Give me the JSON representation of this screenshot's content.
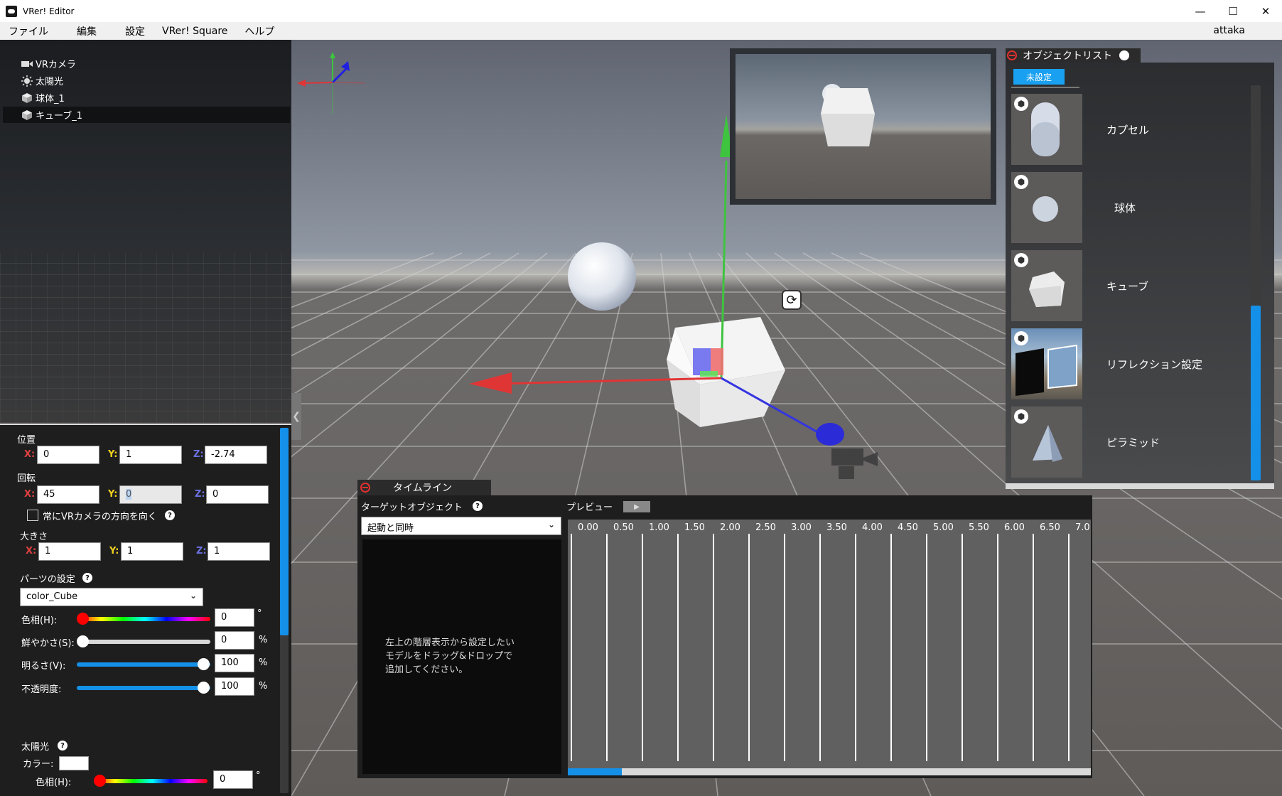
{
  "window": {
    "title": "VRer! Editor",
    "minimize": "—",
    "maximize": "☐",
    "close": "✕"
  },
  "menu": {
    "items": [
      "ファイル",
      "編集",
      "設定",
      "VRer! Square",
      "ヘルプ"
    ],
    "user": "attaka"
  },
  "hierarchy": {
    "items": [
      {
        "label": "VRカメラ",
        "icon": "camera-icon"
      },
      {
        "label": "太陽光",
        "icon": "sun-icon"
      },
      {
        "label": "球体_1",
        "icon": "cube-icon"
      },
      {
        "label": "キューブ_1",
        "icon": "cube-icon",
        "selected": true
      }
    ]
  },
  "inspector": {
    "position": {
      "label": "位置",
      "x": "0",
      "y": "1",
      "z": "-2.74"
    },
    "rotation": {
      "label": "回転",
      "x": "45",
      "y": "0",
      "z": "0"
    },
    "face_camera": {
      "label": "常にVRカメラの方向を向く",
      "checked": false
    },
    "scale": {
      "label": "大きさ",
      "x": "1",
      "y": "1",
      "z": "1"
    },
    "axis_labels": {
      "x": "X:",
      "y": "Y:",
      "z": "Z:"
    },
    "parts": {
      "label": "パーツの設定",
      "selected": "color_Cube"
    },
    "hue": {
      "label": "色相(H):",
      "value": "0",
      "unit": "°",
      "level": 0
    },
    "saturation": {
      "label": "鮮やかさ(S):",
      "value": "0",
      "unit": "%",
      "level": 0
    },
    "brightness": {
      "label": "明るさ(V):",
      "value": "100",
      "unit": "%",
      "level": 1
    },
    "opacity": {
      "label": "不透明度:",
      "value": "100",
      "unit": "%",
      "level": 1
    },
    "sunlight": {
      "label": "太陽光",
      "color_label": "カラー:",
      "hue_label": "色相(H):",
      "hue_value": "0",
      "hue_unit": "°"
    },
    "help_glyph": "?"
  },
  "object_list": {
    "title": "オブジェクトリスト",
    "tab": "未設定",
    "items": [
      {
        "name": "カプセル",
        "icon": "capsule"
      },
      {
        "name": "球体",
        "icon": "sphere"
      },
      {
        "name": "キューブ",
        "icon": "cube"
      },
      {
        "name": "リフレクション設定",
        "icon": "reflection"
      },
      {
        "name": "ピラミッド",
        "icon": "pyramid"
      }
    ]
  },
  "timeline": {
    "title": "タイムライン",
    "target_label": "ターゲットオブジェクト",
    "preview_label": "プレビュー",
    "trigger": "起動と同時",
    "hint": [
      "左上の階層表示から設定したい",
      "モデルをドラッグ&ドロップで",
      "追加してください。"
    ],
    "ticks": [
      "0.00",
      "0.50",
      "1.00",
      "1.50",
      "2.00",
      "2.50",
      "3.00",
      "3.50",
      "4.00",
      "4.50",
      "5.00",
      "5.50",
      "6.00",
      "6.50",
      "7.0"
    ]
  },
  "colors": {
    "accent": "#1590e8",
    "tab_blue": "#1aa0f0",
    "axis_x": "#e04040",
    "axis_y": "#f0d020",
    "axis_z": "#6b70e0"
  }
}
